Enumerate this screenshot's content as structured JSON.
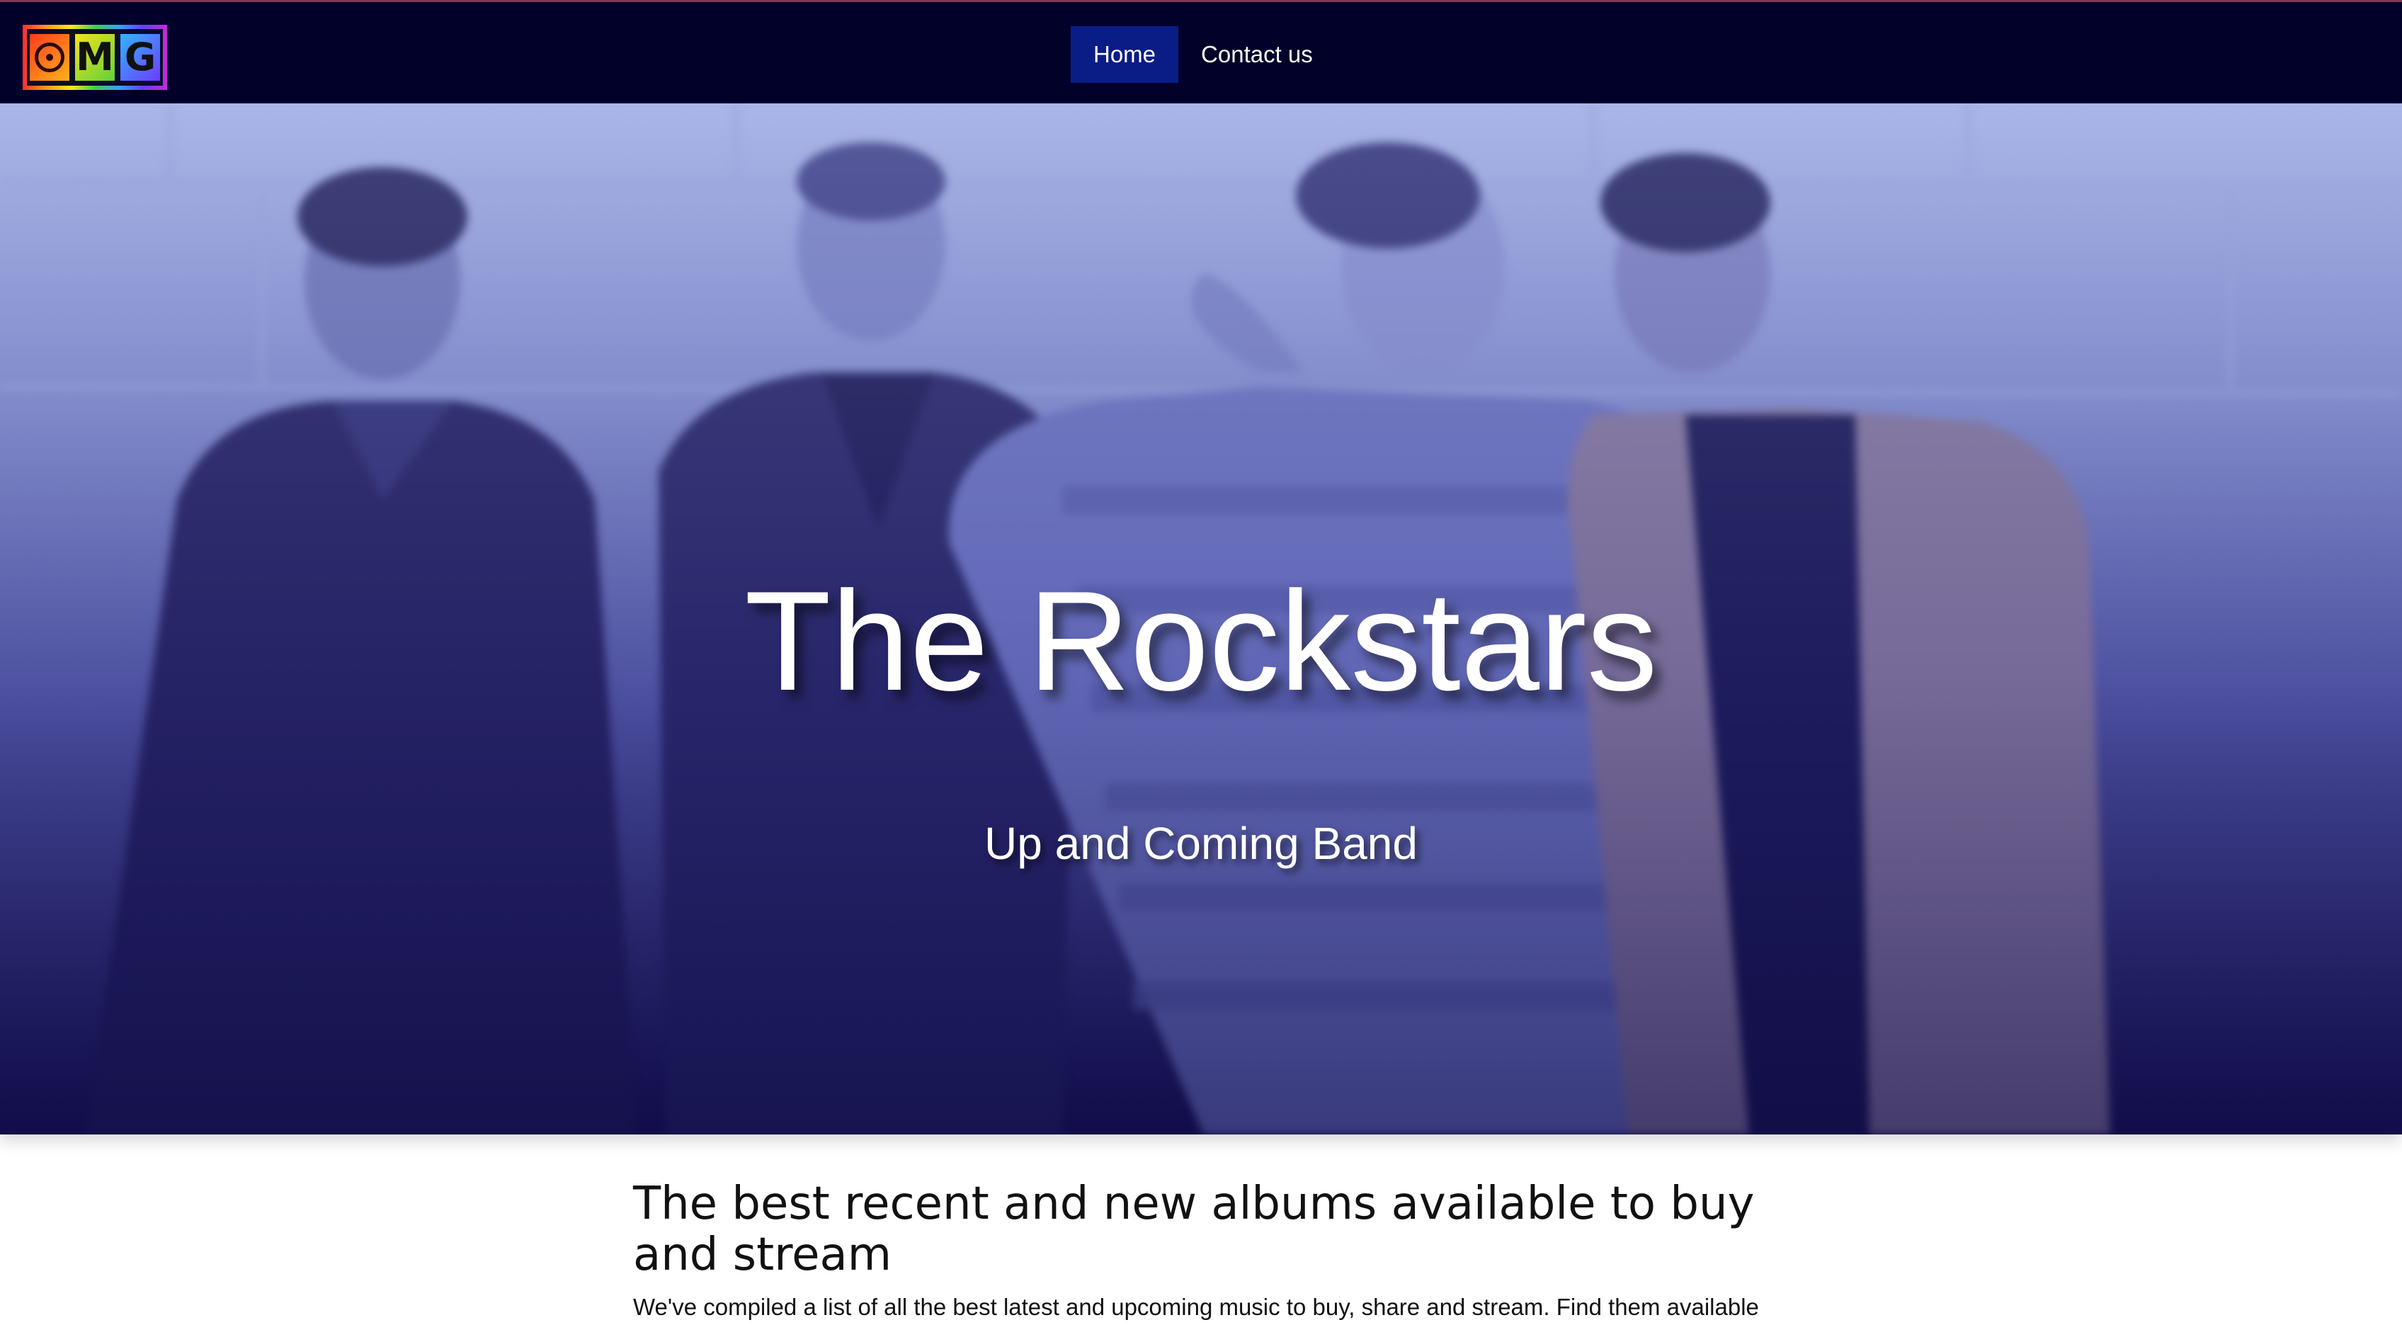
{
  "header": {
    "logo_letters": [
      "M",
      "G"
    ],
    "logo_text": "OMG",
    "nav": [
      {
        "label": "Home",
        "active": true
      },
      {
        "label": "Contact us",
        "active": false
      }
    ]
  },
  "hero": {
    "title": "The Rockstars",
    "subtitle": "Up and Coming Band"
  },
  "main": {
    "heading": "The best recent and new albums available to buy and stream",
    "intro": "We've compiled a list of all the best latest and upcoming music to buy, share and stream. Find them available"
  },
  "colors": {
    "navbar_bg": "#02012a",
    "nav_active_bg": "#0a1c86",
    "hero_tint_top": "#aab6e8",
    "hero_tint_bottom": "#15104e"
  },
  "icons": {
    "logo": "omg-rainbow-logo",
    "logo_disc": "vinyl-record-icon"
  }
}
